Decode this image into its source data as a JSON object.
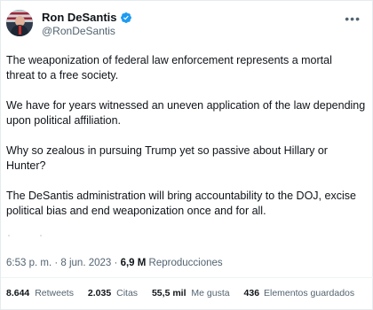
{
  "author": {
    "name": "Ron DeSantis",
    "handle": "@RonDeSantis"
  },
  "tweet": {
    "paragraphs": [
      "The weaponization of federal law enforcement represents a mortal\nthreat to a free society.",
      "We have for years witnessed an uneven application of the law depending\nupon political affiliation.",
      "Why so zealous in pursuing Trump yet so passive about Hillary or\nHunter?",
      "The DeSantis administration will bring accountability to the DOJ, excise\npolitical bias and end weaponization once and for all."
    ]
  },
  "meta": {
    "time": "6:53 p. m.",
    "separator": "·",
    "date": "8 jun. 2023",
    "views_count": "6,9 M",
    "views_label": "Reproducciones"
  },
  "stats": {
    "retweets_count": "8.644",
    "retweets_label": "Retweets",
    "quotes_count": "2.035",
    "quotes_label": "Citas",
    "likes_count": "55,5 mil",
    "likes_label": "Me gusta",
    "saved_count": "436",
    "saved_label": "Elementos guardados"
  },
  "colors": {
    "verified": "#1d9bf0",
    "text": "#0f1419",
    "muted": "#536471"
  },
  "icons": {
    "avatar": "profile-photo",
    "verified": "verified-badge-icon",
    "more": "more-horizontal-icon"
  }
}
